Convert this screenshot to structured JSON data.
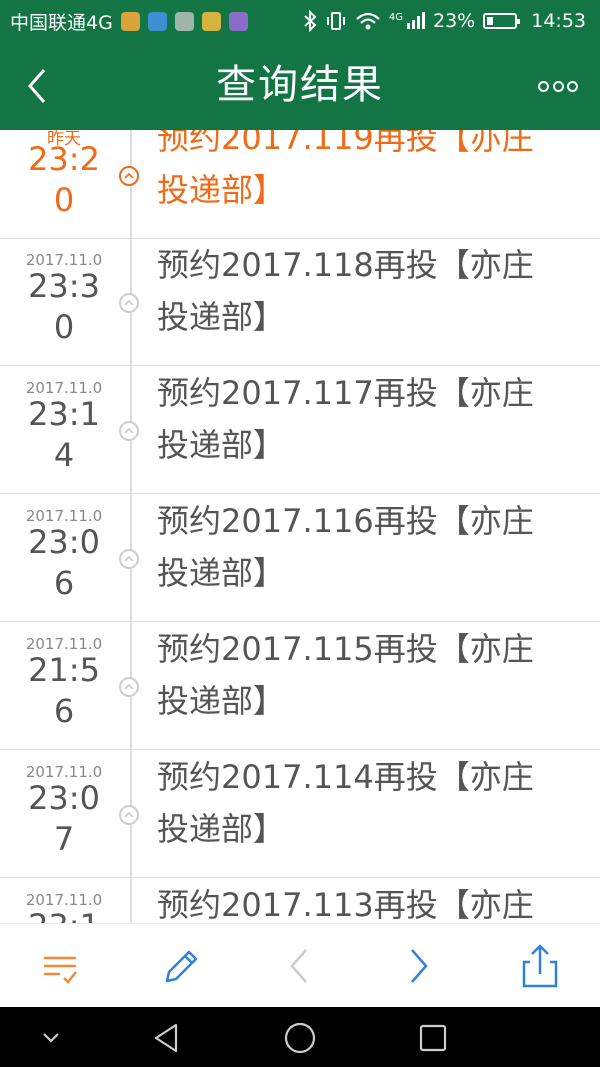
{
  "status_bar": {
    "carrier": "中国联通4G",
    "network_badge": "4G",
    "battery_percent": "23%",
    "battery_level": 0.23,
    "time": "14:53"
  },
  "app_bar": {
    "title": "查询结果"
  },
  "records": [
    {
      "date": "昨天",
      "time": "23:20",
      "text": "预约2017.119再投【亦庄投递部】",
      "active": true
    },
    {
      "date": "2017.11.0",
      "time": "23:30",
      "text": "预约2017.118再投【亦庄投递部】",
      "active": false
    },
    {
      "date": "2017.11.0",
      "time": "23:14",
      "text": "预约2017.117再投【亦庄投递部】",
      "active": false
    },
    {
      "date": "2017.11.0",
      "time": "23:06",
      "text": "预约2017.116再投【亦庄投递部】",
      "active": false
    },
    {
      "date": "2017.11.0",
      "time": "21:56",
      "text": "预约2017.115再投【亦庄投递部】",
      "active": false
    },
    {
      "date": "2017.11.0",
      "time": "23:07",
      "text": "预约2017.114再投【亦庄投递部】",
      "active": false
    },
    {
      "date": "2017.11.0",
      "time": "23:1",
      "text": "预约2017.113再投【亦庄投",
      "active": false
    }
  ],
  "colors": {
    "brand_green": "#137544",
    "accent_orange": "#f06a18",
    "icon_blue": "#2f82d6",
    "text_gray": "#555555"
  },
  "icons": {
    "toolbar": [
      "checklist-icon",
      "pencil-icon",
      "chevron-left-icon",
      "chevron-right-icon",
      "share-icon"
    ],
    "navbar": [
      "collapse-chevron-icon",
      "back-triangle-icon",
      "home-circle-icon",
      "recents-square-icon"
    ]
  }
}
